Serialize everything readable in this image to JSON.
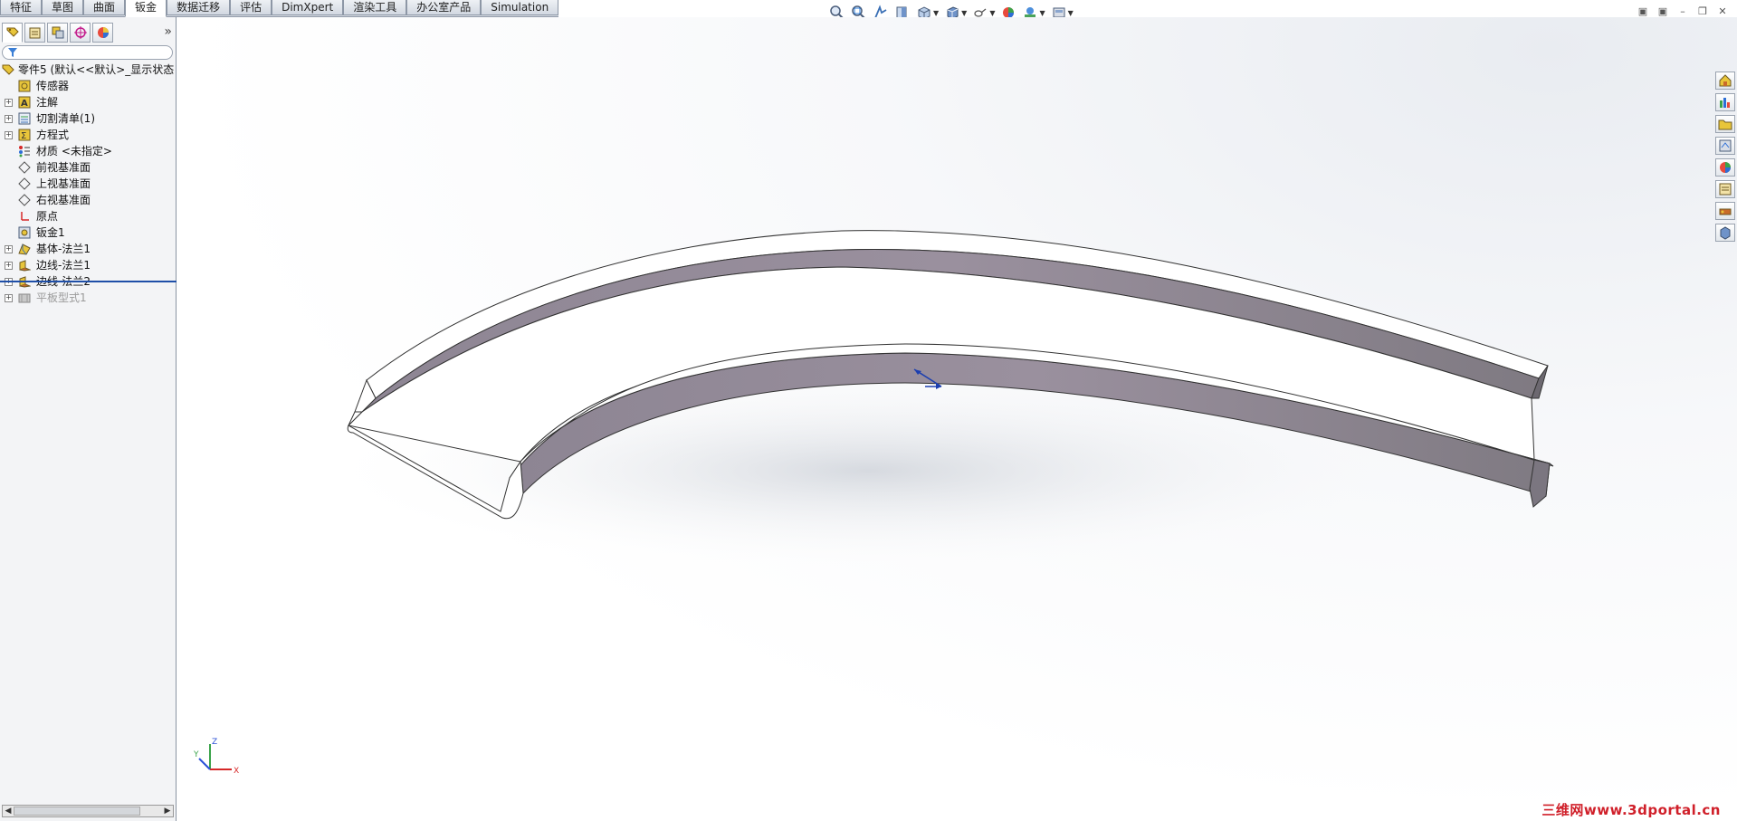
{
  "tabs": [
    {
      "label": "特征"
    },
    {
      "label": "草图"
    },
    {
      "label": "曲面"
    },
    {
      "label": "钣金"
    },
    {
      "label": "数据迁移"
    },
    {
      "label": "评估"
    },
    {
      "label": "DimXpert"
    },
    {
      "label": "渲染工具"
    },
    {
      "label": "办公室产品"
    },
    {
      "label": "Simulation"
    }
  ],
  "active_tab_index": 3,
  "hud_icons": [
    "zoom-to-fit-icon",
    "zoom-area-icon",
    "previous-view-icon",
    "section-view-icon",
    "view-orientation-icon",
    "display-style-icon",
    "hide-show-icon",
    "edit-appearance-icon",
    "apply-scene-icon",
    "view-settings-icon"
  ],
  "window_controls": {
    "minimize": "–",
    "restore": "❐",
    "close": "✕"
  },
  "panel": {
    "manager_tabs": [
      "featuremanager-icon",
      "propertymanager-icon",
      "configurationmanager-icon",
      "dimxpertmanager-icon",
      "displaymanager-icon"
    ],
    "expand_symbol": "»",
    "tree": {
      "root": "零件5  (默认<<默认>_显示状态",
      "items": [
        {
          "label": "传感器",
          "expandable": false,
          "icon": "sensor-icon"
        },
        {
          "label": "注解",
          "expandable": true,
          "icon": "annotations-icon"
        },
        {
          "label": "切割清单(1)",
          "expandable": true,
          "icon": "cut-list-icon"
        },
        {
          "label": "方程式",
          "expandable": true,
          "icon": "equations-icon"
        },
        {
          "label": "材质 <未指定>",
          "expandable": false,
          "icon": "material-icon"
        },
        {
          "label": "前视基准面",
          "expandable": false,
          "icon": "plane-icon"
        },
        {
          "label": "上视基准面",
          "expandable": false,
          "icon": "plane-icon"
        },
        {
          "label": "右视基准面",
          "expandable": false,
          "icon": "plane-icon"
        },
        {
          "label": "原点",
          "expandable": false,
          "icon": "origin-icon"
        },
        {
          "label": "钣金1",
          "expandable": false,
          "icon": "sheet-metal-icon"
        },
        {
          "label": "基体-法兰1",
          "expandable": true,
          "icon": "base-flange-icon"
        },
        {
          "label": "边线-法兰1",
          "expandable": true,
          "icon": "edge-flange-icon"
        },
        {
          "label": "边线-法兰2",
          "expandable": true,
          "icon": "edge-flange-icon"
        },
        {
          "label": "平板型式1",
          "expandable": true,
          "icon": "flat-pattern-icon",
          "suppressed": true
        }
      ]
    }
  },
  "taskpane_icons": [
    "resources-icon",
    "design-library-icon",
    "file-explorer-icon",
    "view-palette-icon",
    "appearances-icon",
    "custom-properties-icon",
    "toolbox-icon",
    "3d-content-icon"
  ],
  "triad": {
    "x": "X",
    "y": "Y",
    "z": "Z"
  },
  "watermark": "三维网www.3dportal.cn",
  "colors": {
    "accent": "#1f4fa8",
    "tab_bg": "#d9dde4",
    "model_face": "#ffffff",
    "model_wall": "#8e8692"
  }
}
